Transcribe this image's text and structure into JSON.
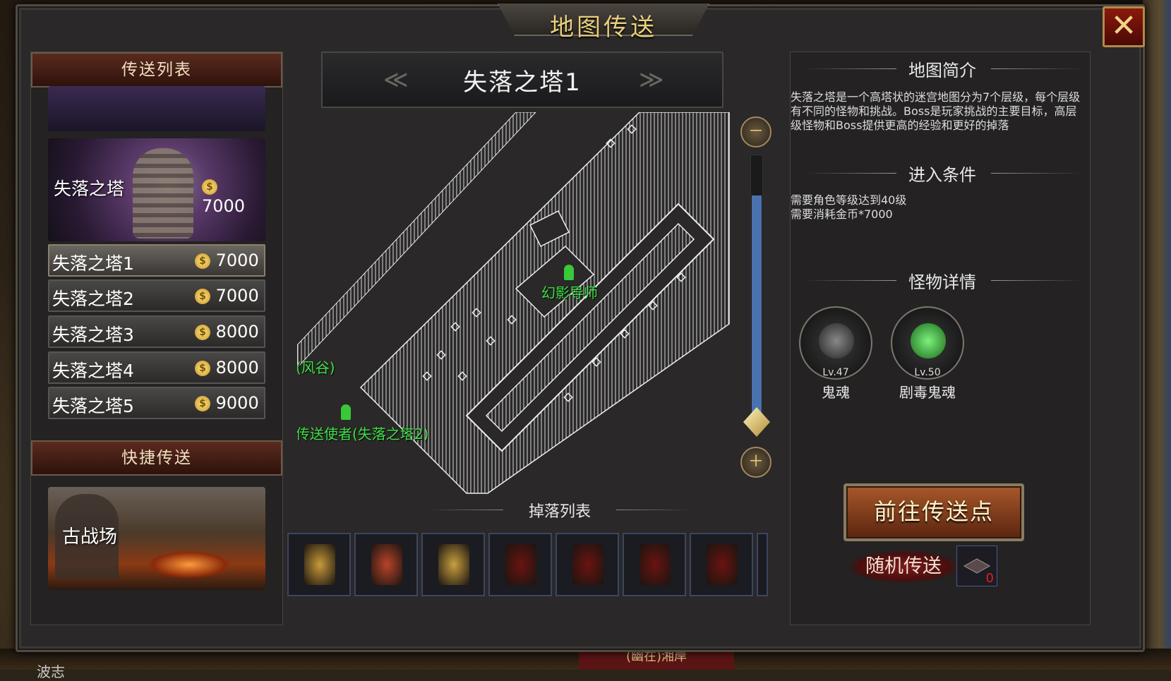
{
  "window": {
    "title": "地图传送",
    "close_label": "✕"
  },
  "left_panel": {
    "list_title": "传送列表",
    "cards": [
      {
        "name": "失落之塔",
        "price": "7000"
      }
    ],
    "levels": [
      {
        "name": "失落之塔1",
        "price": "7000",
        "selected": true
      },
      {
        "name": "失落之塔2",
        "price": "7000",
        "selected": false
      },
      {
        "name": "失落之塔3",
        "price": "8000",
        "selected": false
      },
      {
        "name": "失落之塔4",
        "price": "8000",
        "selected": false
      },
      {
        "name": "失落之塔5",
        "price": "9000",
        "selected": false
      }
    ],
    "quick_title": "快捷传送",
    "quick_card": {
      "name": "古战场"
    }
  },
  "center": {
    "map_title": "失落之塔1",
    "prev_arrow": "≪",
    "next_arrow": "≫",
    "map_labels": {
      "npc_phantom": "幻影导师",
      "wind_valley": "(风谷)",
      "teleporter": "传送使者(失落之塔2)"
    },
    "zoom_out": "－",
    "zoom_in": "＋",
    "zoom_level": 0.85,
    "drop_title": "掉落列表",
    "drops": [
      {
        "icon": "amber-gem-icon",
        "color": "#c89a3a"
      },
      {
        "icon": "demon-eye-icon",
        "color": "#b8442a"
      },
      {
        "icon": "skull-key-icon",
        "color": "#c8a040"
      },
      {
        "icon": "red-book-icon",
        "color": "#6a1410"
      },
      {
        "icon": "red-book-icon",
        "color": "#6a1410"
      },
      {
        "icon": "red-book-icon",
        "color": "#6a1410"
      },
      {
        "icon": "red-book-icon",
        "color": "#6a1410"
      }
    ]
  },
  "right_panel": {
    "intro_title": "地图简介",
    "intro_text": "失落之塔是一个高塔状的迷宫地图分为7个层级，每个层级有不同的怪物和挑战。Boss是玩家挑战的主要目标，高层级怪物和Boss提供更高的经验和更好的掉落",
    "cond_title": "进入条件",
    "cond_lines": [
      "需要角色等级达到40级",
      "需要消耗金币*7000"
    ],
    "monster_title": "怪物详情",
    "monsters": [
      {
        "name": "鬼魂",
        "level": "Lv.47",
        "color": "#555555"
      },
      {
        "name": "剧毒鬼魂",
        "level": "Lv.50",
        "color": "#3aa83a"
      }
    ],
    "go_button": "前往传送点",
    "random_button": "随机传送",
    "random_count": "0"
  },
  "background": {
    "bottom_tag": "(幽在)湘岸",
    "bottom_left": "波志"
  },
  "colors": {
    "accent_gold": "#e8cf7e",
    "npc_green": "#3ee046",
    "close_red": "#8a1a0c"
  }
}
